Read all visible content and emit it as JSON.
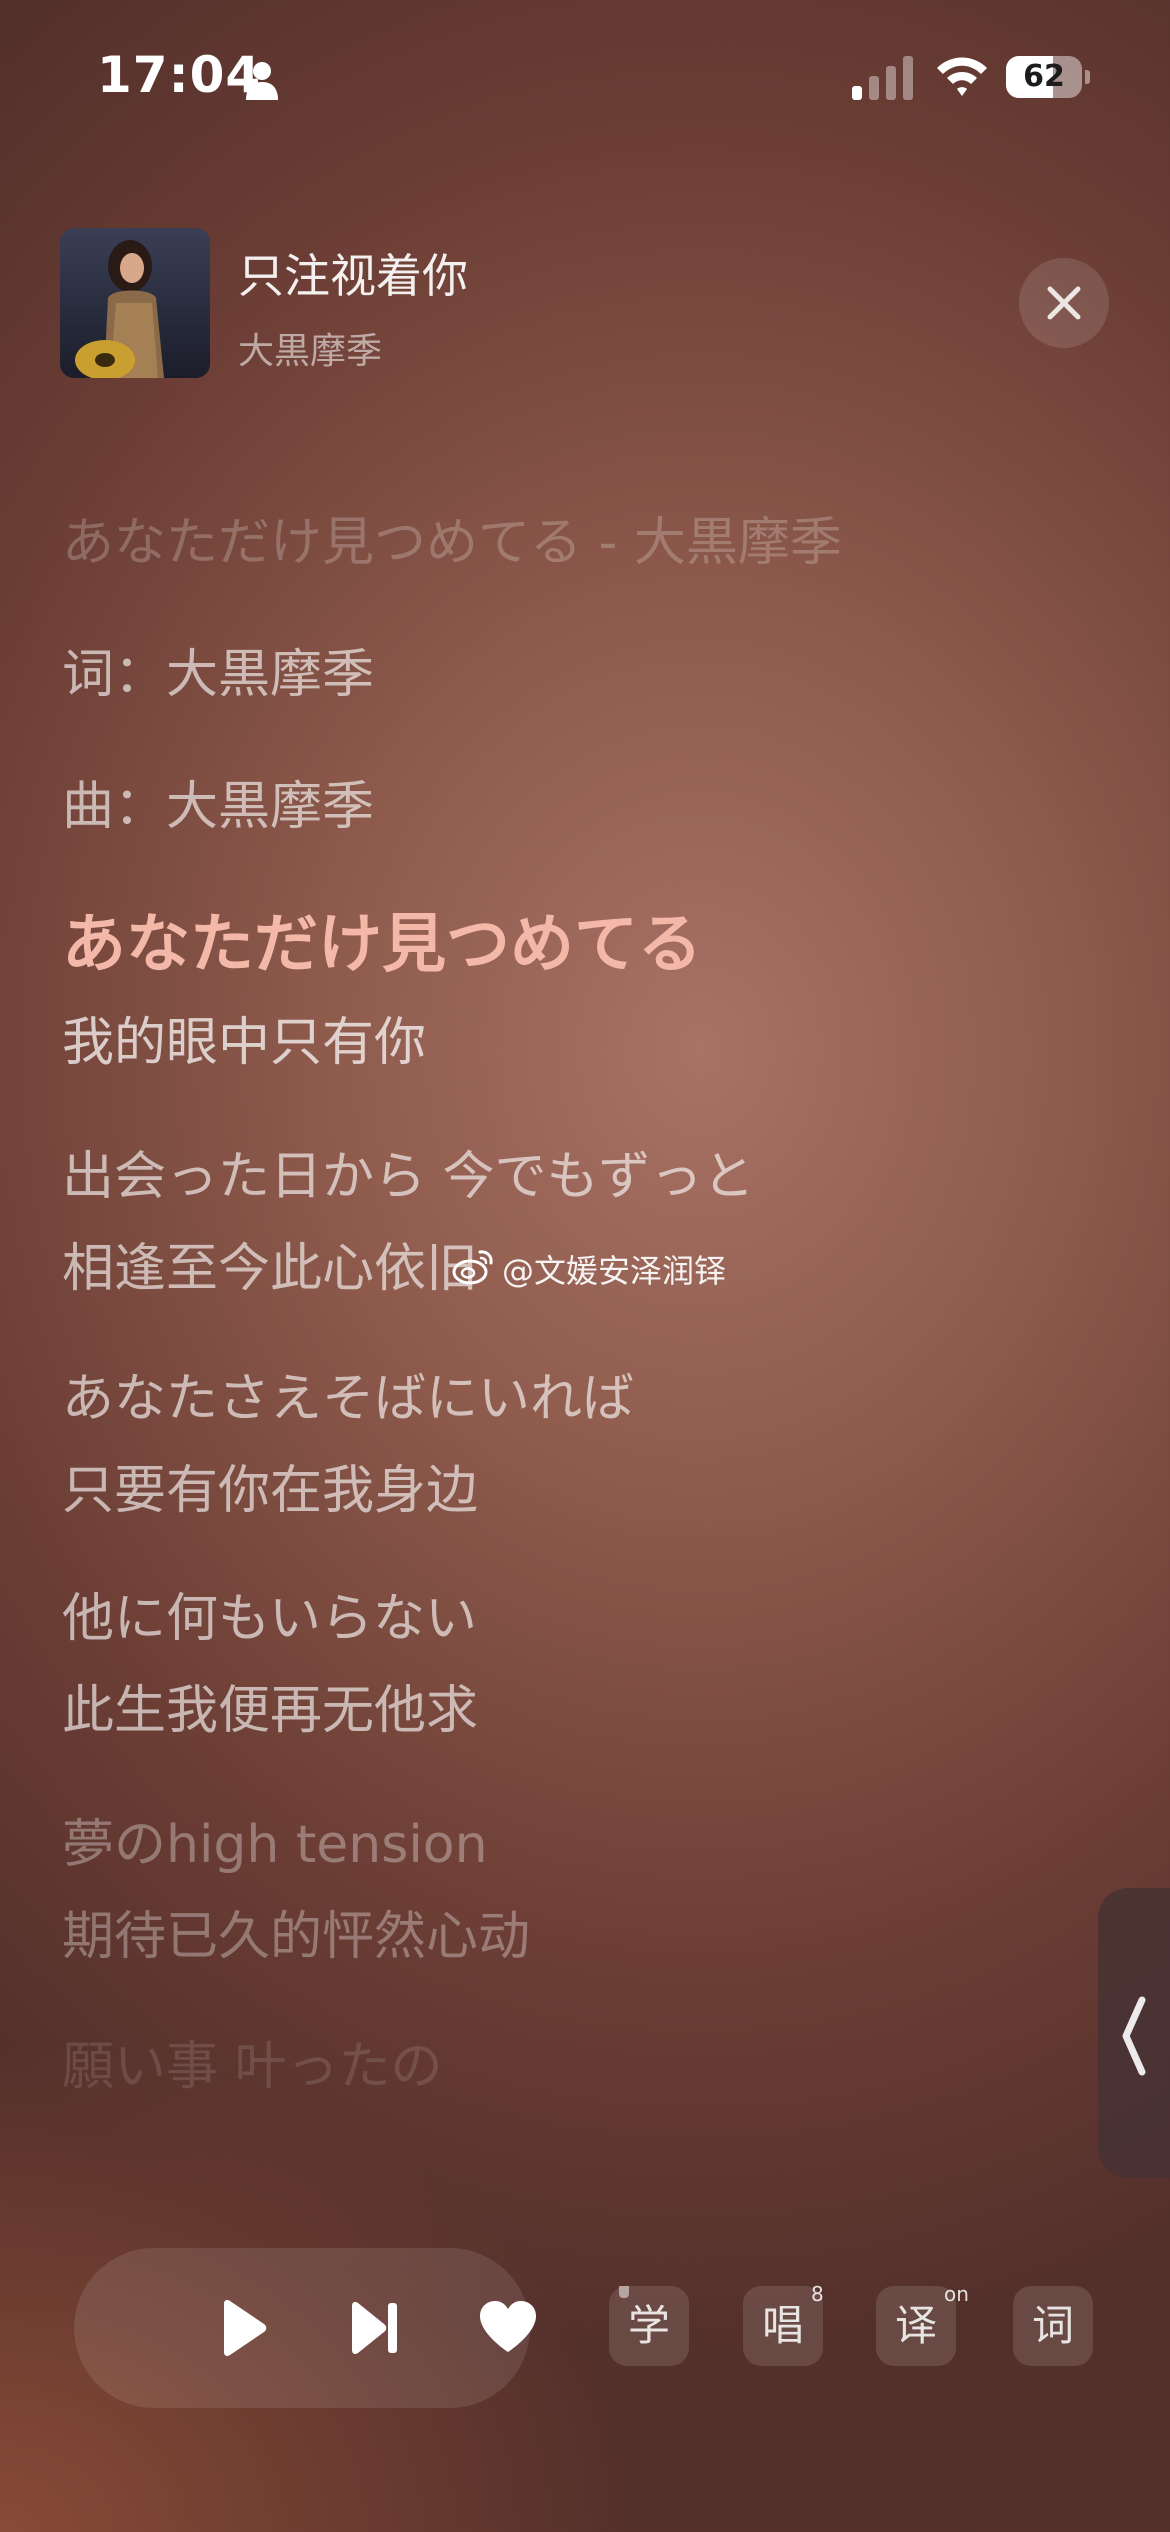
{
  "status_bar": {
    "time": "17:04",
    "battery": "62",
    "battery_level": 0.62
  },
  "song": {
    "title": "只注视着你",
    "artist": "大黒摩季"
  },
  "lyrics": [
    {
      "text": "あなただけ見つめてる - 大黒摩季",
      "style": "dim"
    },
    {
      "text": "词：大黒摩季",
      "style": "normal"
    },
    {
      "text": "曲：大黒摩季",
      "style": "normal"
    },
    {
      "text": "あなただけ見つめてる",
      "style": "active"
    },
    {
      "text": "我的眼中只有你",
      "style": "active-translation"
    },
    {
      "text": "出会った日から 今でもずっと",
      "style": "normal"
    },
    {
      "text": "相逢至今此心依旧",
      "style": "normal"
    },
    {
      "text": "あなたさえそばにいれば",
      "style": "normal"
    },
    {
      "text": "只要有你在我身边",
      "style": "normal"
    },
    {
      "text": "他に何もいらない",
      "style": "normal"
    },
    {
      "text": "此生我便再无他求",
      "style": "normal"
    },
    {
      "text": "夢のhigh tension",
      "style": "faint"
    },
    {
      "text": "期待已久的怦然心动",
      "style": "faint"
    },
    {
      "text": "願い事 叶ったの",
      "style": "fade"
    }
  ],
  "watermark": "@文媛安泽润铎",
  "controls": {
    "learn": "学",
    "sing": "唱",
    "sing_badge": "8",
    "translate": "译",
    "translate_badge": "on",
    "lyrics": "词"
  },
  "icons": {
    "play": "play-icon",
    "next": "next-track-icon",
    "favorite": "heart-icon",
    "close": "close-icon",
    "collapse": "chevron-left-icon"
  },
  "colors": {
    "active_lyric": "#f4b8a8",
    "background": "#8d5a4c"
  }
}
